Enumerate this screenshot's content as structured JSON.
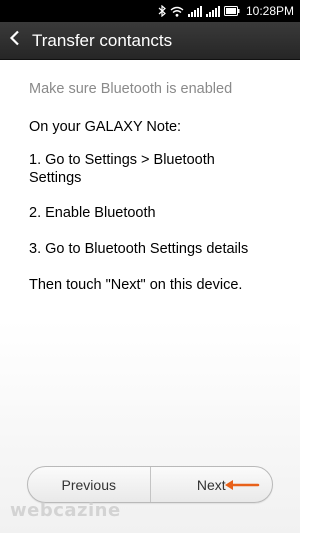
{
  "status_bar": {
    "time": "10:28PM",
    "icons": [
      "bluetooth-icon",
      "wifi-icon",
      "signal-icon",
      "battery-icon"
    ]
  },
  "action_bar": {
    "title": "Transfer contancts",
    "back_icon": "chevron-left-icon"
  },
  "content": {
    "hint": "Make sure Bluetooth is enabled",
    "heading": "On your GALAXY Note:",
    "step1_line1": "1. Go to Settings > Bluetooth",
    "step1_line2": "Settings",
    "step2": "2. Enable Bluetooth",
    "step3": "3. Go to Bluetooth Settings details",
    "footer": "Then touch \"Next\" on this device."
  },
  "buttons": {
    "previous": "Previous",
    "next": "Next"
  },
  "annotation": {
    "arrow_color": "#e8611a"
  },
  "watermark": "webcazine"
}
